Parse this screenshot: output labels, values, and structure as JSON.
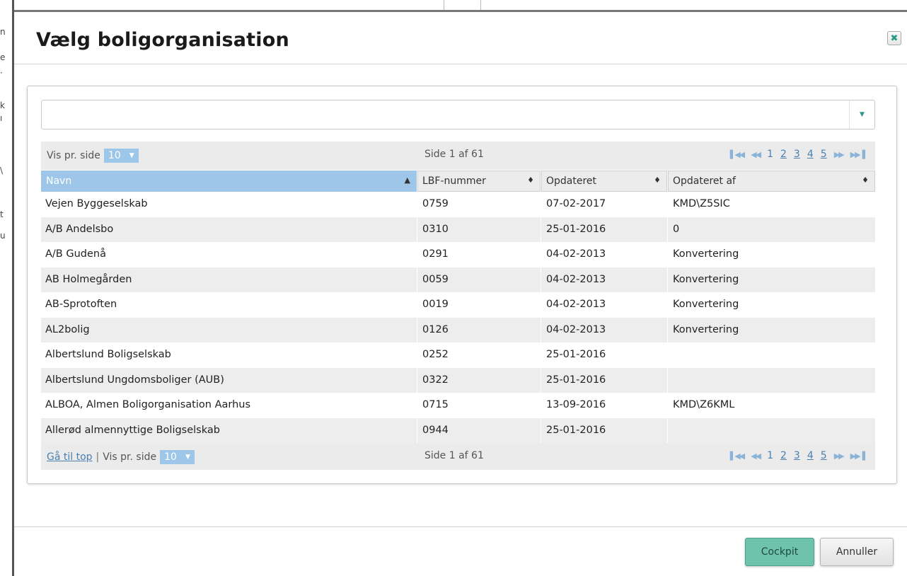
{
  "dialog": {
    "title": "Vælg boligorganisation",
    "close_icon": "close-icon"
  },
  "search": {
    "value": "",
    "placeholder": "",
    "dropdown_icon": "caret-down-icon"
  },
  "pager_top": {
    "per_page_label": "Vis pr. side",
    "per_page_value": "10",
    "page_info": "Side 1 af 61",
    "pages": [
      "1",
      "2",
      "3",
      "4",
      "5"
    ],
    "current_page": "1"
  },
  "pager_bottom": {
    "goto_top": "Gå til top",
    "separator": "|",
    "per_page_label": "Vis pr. side",
    "per_page_value": "10",
    "page_info": "Side 1 af 61",
    "pages": [
      "1",
      "2",
      "3",
      "4",
      "5"
    ]
  },
  "columns": [
    {
      "label": "Navn",
      "sort": "▲"
    },
    {
      "label": "LBF-nummer",
      "sort": "♦"
    },
    {
      "label": "Opdateret",
      "sort": "♦"
    },
    {
      "label": "Opdateret af",
      "sort": "♦"
    }
  ],
  "rows": [
    [
      "Vejen Byggeselskab",
      "0759",
      "07-02-2017",
      "KMD\\Z5SIC"
    ],
    [
      "A/B Andelsbo",
      "0310",
      "25-01-2016",
      "0"
    ],
    [
      "A/B Gudenå",
      "0291",
      "04-02-2013",
      "Konvertering"
    ],
    [
      "AB Holmegården",
      "0059",
      "04-02-2013",
      "Konvertering"
    ],
    [
      "AB-Sprotoften",
      "0019",
      "04-02-2013",
      "Konvertering"
    ],
    [
      "AL2bolig",
      "0126",
      "04-02-2013",
      "Konvertering"
    ],
    [
      "Albertslund Boligselskab",
      "0252",
      "25-01-2016",
      ""
    ],
    [
      "Albertslund Ungdomsboliger (AUB)",
      "0322",
      "25-01-2016",
      ""
    ],
    [
      "ALBOA, Almen Boligorganisation Aarhus",
      "0715",
      "13-09-2016",
      "KMD\\Z6KML"
    ],
    [
      "Allerød almennyttige Boligselskab",
      "0944",
      "25-01-2016",
      ""
    ]
  ],
  "buttons": {
    "cockpit": "Cockpit",
    "cancel": "Annuller"
  },
  "colors": {
    "accent": "#6fc2ae",
    "header_active": "#9dc6e8",
    "link": "#4a7fb0"
  }
}
